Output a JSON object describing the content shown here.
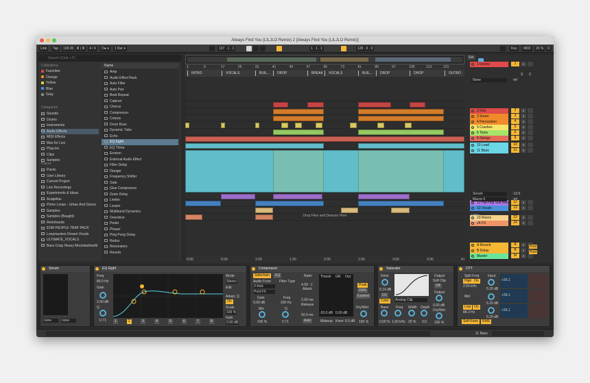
{
  "window": {
    "title": "Always Find You (LILJLO Remix) 2  [Always Find You (LILJLO Remix)]"
  },
  "transport": {
    "link": "Link",
    "tap": "Tap",
    "tempo": "128.00",
    "tempo_glyph": "Ⅲ | Ⅲ",
    "signature": "4 / 4",
    "metro": "O● ▾",
    "quantize": "1 Bar ▾",
    "position": "137 .  1 .  1",
    "loop_start": "1 .  1 .  1",
    "loop_len": "128 .  0 .  0",
    "key": "Key",
    "midi": "MIDI",
    "cpu": "20 %",
    "d_label": "D"
  },
  "browser": {
    "search_placeholder": "Search (Cmd + F)",
    "collections_header": "Collections",
    "collections": [
      {
        "label": "Favorites",
        "color": "#e04a4a"
      },
      {
        "label": "Orange",
        "color": "#f08a2a"
      },
      {
        "label": "Yellow",
        "color": "#e6d33a"
      },
      {
        "label": "Blue",
        "color": "#4a90d9"
      },
      {
        "label": "Gray",
        "color": "#8a8a8a"
      }
    ],
    "categories_header": "Categories",
    "categories": [
      "Sounds",
      "Drums",
      "Instruments",
      "Audio Effects",
      "MIDI Effects",
      "Max for Live",
      "Plug-ins",
      "Clips",
      "Samples"
    ],
    "selected_category": "Audio Effects",
    "places_header": "Places",
    "places": [
      "Packs",
      "User Library",
      "Current Project",
      "Live Recordings",
      "Experiments & Ideas",
      "Acapellas",
      "Prime Loops - Urban And Dance ",
      "Samples",
      "Samples (Bought)",
      "Retrohands",
      "EDM PEOPLE TRAP PACK",
      "Loopmasters Dream Vocals",
      "ULTIMATE_VOCALS",
      "Bass Crisp Heavy MoombahtonM"
    ],
    "name_header": "Name",
    "items": [
      "Amp",
      "Audio Effect Rack",
      "Auto Filter",
      "Auto Pan",
      "Beat Repeat",
      "Cabinet",
      "Chorus",
      "Compressor",
      "Corpus",
      "Drum Buss",
      "Dynamic Tube",
      "Echo",
      "EQ Eight",
      "EQ Three",
      "Erosion",
      "External Audio Effect",
      "Filter Delay",
      "Flanger",
      "Frequency Shifter",
      "Gate",
      "Glue Compressor",
      "Grain Delay",
      "Limiter",
      "Looper",
      "Multiband Dynamics",
      "Overdrive",
      "Pedal",
      "Phaser",
      "Ping Pong Delay",
      "Redux",
      "Resonators",
      "Reverb"
    ],
    "selected_item": "EQ Eight"
  },
  "ruler": [
    "1",
    "9",
    "17",
    "25",
    "33",
    "41",
    "49",
    "57",
    "65",
    "73",
    "81",
    "89",
    "97",
    "105",
    "113",
    "121"
  ],
  "locators": [
    "INTRO",
    "VOCALS",
    "BUIL...",
    "DROP",
    "BREAK",
    "VOCALS",
    "BUIL...",
    "DROP",
    "DROP",
    "OUTRO"
  ],
  "timeline": [
    "0:00",
    "0:30",
    "1:00",
    "1:30",
    "2:00",
    "2:30",
    "3:00",
    "3:30",
    "4:00"
  ],
  "drop_hint": "Drop Files and Devices Here",
  "mixer": {
    "set_label": "Set",
    "tracks": [
      {
        "name": "1 Drums",
        "color": "#e04a4a",
        "num": "1"
      },
      {
        "name": "2 Kick",
        "color": "#e04a4a",
        "num": "2"
      },
      {
        "name": "3 Snare",
        "color": "#f08a2a",
        "num": "3"
      },
      {
        "name": "4 Percussion",
        "color": "#f08a2a",
        "num": "4"
      },
      {
        "name": "5 Crashes",
        "color": "#f6e56a",
        "num": "5"
      },
      {
        "name": "6 Toms",
        "color": "#a6e46a",
        "num": "6"
      },
      {
        "name": "8 Strings",
        "color": "#e56a5a",
        "num": "8"
      },
      {
        "name": "10 Lead",
        "color": "#6ad6e6",
        "num": "10"
      },
      {
        "name": "11 Bass",
        "color": "#6ad6e6",
        "num": "11"
      },
      {
        "name": "12 Hip-Hop Sub Bass",
        "color": "#b07ae6",
        "num": "12"
      },
      {
        "name": "13 Vocals",
        "color": "#4a90d9",
        "num": "13"
      },
      {
        "name": "23 Risers",
        "color": "#f6d38a",
        "num": "23"
      },
      {
        "name": "24 FX",
        "color": "#f0956a",
        "num": "24"
      },
      {
        "name": "A Reverb",
        "color": "#f6b734",
        "num": "A"
      },
      {
        "name": "B Delay",
        "color": "#f6b734",
        "num": "B"
      },
      {
        "name": "Master",
        "color": "#6ae69a",
        "num": "M"
      }
    ],
    "routing_none": "None",
    "inf": "-inf",
    "serum": "Serum",
    "macro": "Macro 4",
    "utility": "Utility",
    "gain": "Gain",
    "val_126": "-12.6",
    "s_label": "S",
    "c_label": "C",
    "post": "Post"
  },
  "devices": {
    "serum": {
      "title": "Serum",
      "none1": "none",
      "none2": "none"
    },
    "eq": {
      "title": "EQ Eight",
      "freq": "Freq",
      "freq_val": "80.0 Hz",
      "gain": "Gain",
      "gain_val": "2.00 dB",
      "q": "Q",
      "q_val": "0.71",
      "mode": "Mode",
      "mode_val": "Stereo",
      "edit": "Edit",
      "adapt": "Adapt. Q",
      "adapt_val": "On",
      "scale": "Scale",
      "scale_val": "100 %",
      "gain2": "Gain",
      "gain2_val": "0.00 dB",
      "bands": [
        "1",
        "2",
        "3",
        "4",
        "5",
        "6",
        "7",
        "8"
      ]
    },
    "comp": {
      "title": "Compressor",
      "sidechain": "Sidechain",
      "eq_btn": "EQ",
      "audio_from": "Audio From",
      "audio_src": "2-Kick",
      "post_fx": "Post FX",
      "filter_type": "Filter Type",
      "gain": "Gain",
      "gain_val": "0.00 dB",
      "mix": "Mix",
      "mix_val": "100 %",
      "freq": "Freq",
      "freq_val": "200 Hz",
      "q": "Q",
      "q_val": "0.71",
      "ratio": "Ratio",
      "ratio_val": "4.00 : 1",
      "attack": "Attack",
      "attack_val": "2.00 ms",
      "release": "Release",
      "release_val": "50.0 ms",
      "auto": "Auto",
      "thresh": "Thresh",
      "gr": "GR",
      "out": "Out",
      "peak": "Peak",
      "rms": "RMS",
      "expand": "Expand",
      "drywet": "Dry/Wet",
      "drywet_val": "100 %",
      "makeup": "Makeup",
      "knee": "Knee",
      "knee_val": "6.0 dB",
      "meter1": "-20.0 dB",
      "meter2": "0.00 dB"
    },
    "sat": {
      "title": "Saturator",
      "drive": "Drive",
      "drive_val": "5.14 dB",
      "dc": "DC",
      "color_btn": "Color",
      "analog": "Analog Clip",
      "base": "Base",
      "base_val": "0.00 %",
      "freq": "Freq",
      "freq_val": "1.00 kHz",
      "width": "Width",
      "width_val": "20 %",
      "depth": "Depth",
      "depth_val": "0.0",
      "output": "Output",
      "output_val": "0.00 dB",
      "soft": "Soft Clip",
      "off": "Off",
      "drywet": "Dry/Wet",
      "drywet_val": "100 %"
    },
    "ott": {
      "title": "OTT",
      "split": "Split Freq",
      "high": "High",
      "on1": "On",
      "high_val": "2.50 kHz",
      "mid": "Mid",
      "low": "Low",
      "on2": "On",
      "low_val": "88.3 Hz",
      "input": "Input",
      "input_val1": "5.20 dB",
      "input_val2": "5.20 dB",
      "input_val3": "5.20 dB",
      "soft_knee": "Soft Knee",
      "rms": "RMS",
      "amount": "+36.1"
    }
  },
  "status": {
    "track_label": "11 Bass"
  }
}
